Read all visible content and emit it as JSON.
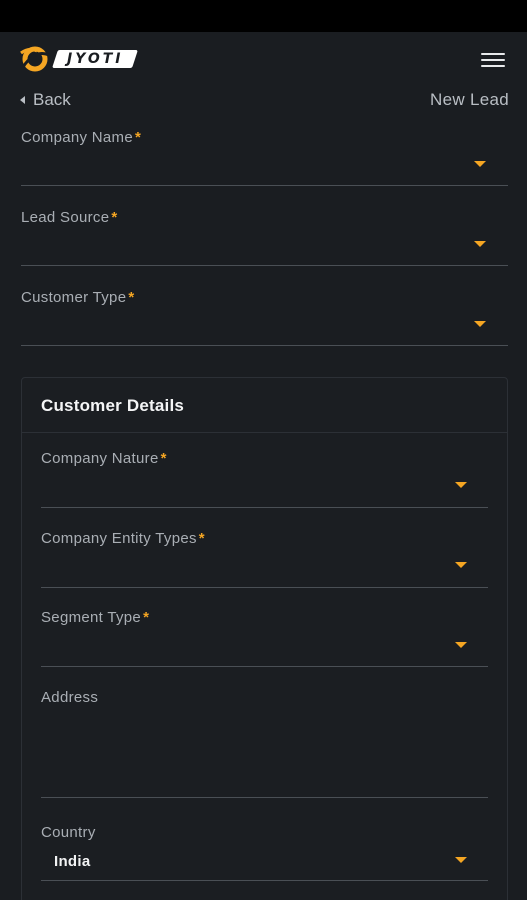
{
  "header": {
    "brand": "JYOTI",
    "menu_icon": "hamburger-menu-icon"
  },
  "nav": {
    "back_label": "Back",
    "page_title": "New Lead"
  },
  "top_fields": [
    {
      "label": "Company Name",
      "required": "*"
    },
    {
      "label": "Lead Source",
      "required": "*"
    },
    {
      "label": "Customer Type",
      "required": "*"
    }
  ],
  "customer_details": {
    "title": "Customer Details",
    "fields": [
      {
        "label": "Company Nature",
        "required": "*"
      },
      {
        "label": "Company Entity Types",
        "required": "*"
      },
      {
        "label": "Segment Type",
        "required": "*"
      },
      {
        "label": "Address"
      },
      {
        "label": "Country",
        "value": "India"
      }
    ]
  },
  "colors": {
    "background": "#1a1d21",
    "accent": "#f5a623",
    "text_muted": "#a9aeb4"
  }
}
